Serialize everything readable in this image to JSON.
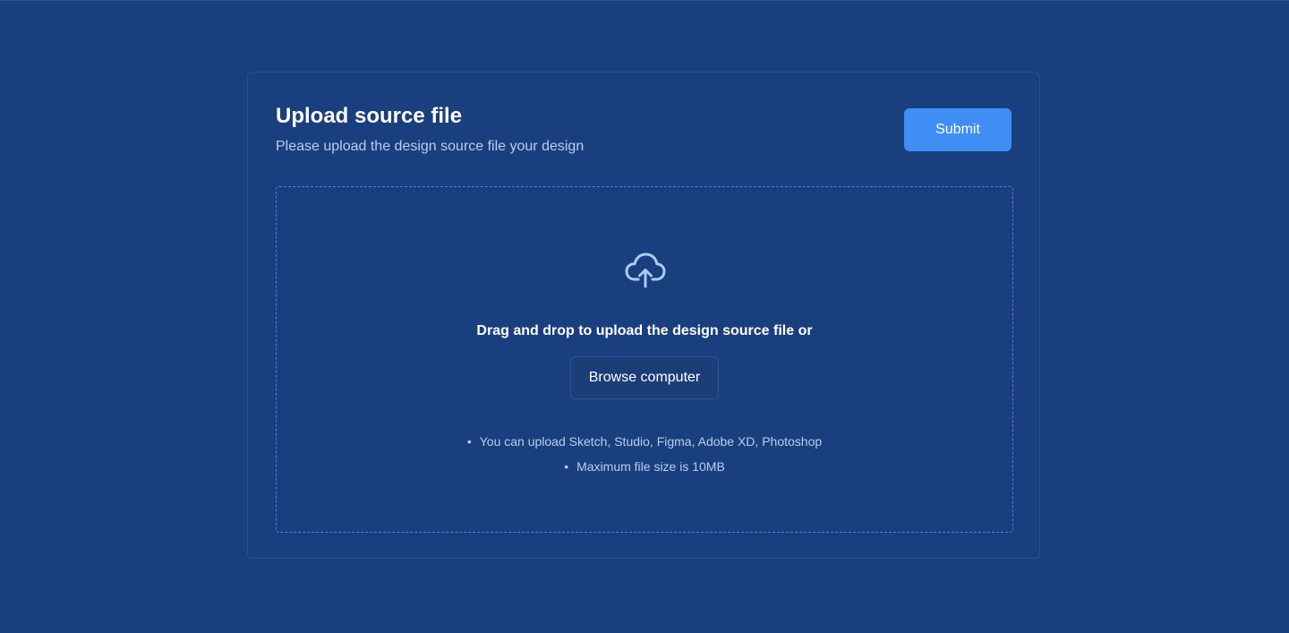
{
  "upload": {
    "title": "Upload source file",
    "subtitle": "Please upload the design source file your design",
    "submit_label": "Submit",
    "drag_text": "Drag and drop to upload the design source file or",
    "browse_label": "Browse computer",
    "notes": [
      "You can upload Sketch, Studio, Figma, Adobe XD, Photoshop",
      "Maximum file size is 10MB"
    ],
    "icon": "cloud-upload-icon"
  },
  "colors": {
    "background": "#1a3f7e",
    "accent": "#3f8ef3",
    "dropzone_border": "#3f86e6",
    "icon": "#a9cdf6",
    "muted_text": "#b9cdef"
  }
}
